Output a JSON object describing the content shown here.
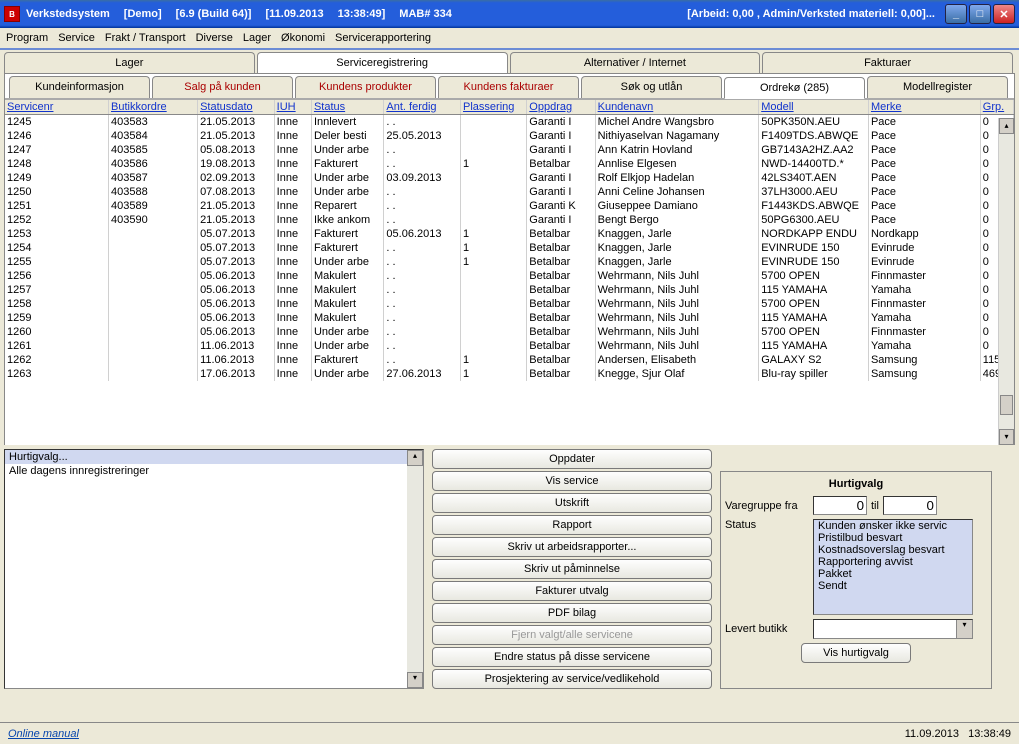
{
  "titlebar": {
    "app": "Verkstedsystem",
    "demo": "[Demo]",
    "build": "[6.9 (Build 64)]",
    "date": "[11.09.2013",
    "time": "13:38:49]",
    "mab": "MAB# 334",
    "right": "[Arbeid: 0,00 , Admin/Verksted materiell: 0,00]..."
  },
  "menu": [
    "Program",
    "Service",
    "Frakt / Transport",
    "Diverse",
    "Lager",
    "Økonomi",
    "Servicerapportering"
  ],
  "tabs_level1": [
    "Lager",
    "Serviceregistrering",
    "Alternativer / Internet",
    "Fakturaer"
  ],
  "tabs_level1_active": 1,
  "tabs_level2": [
    {
      "label": "Kundeinformasjon",
      "red": false
    },
    {
      "label": "Salg på kunden",
      "red": true
    },
    {
      "label": "Kundens produkter",
      "red": true
    },
    {
      "label": "Kundens fakturaer",
      "red": true
    },
    {
      "label": "Søk og utlån",
      "red": false
    },
    {
      "label": "Ordrekø (285)",
      "red": false,
      "active": true
    },
    {
      "label": "Modellregister",
      "red": false
    }
  ],
  "columns": [
    "Servicenr",
    "Butikkordre",
    "Statusdato",
    "IUH",
    "Status",
    "Ant. ferdig",
    "Plassering",
    "Oppdrag",
    "Kundenavn",
    "Modell",
    "Merke",
    "Grp."
  ],
  "rows": [
    {
      "c": [
        "1245",
        "403583",
        "21.05.2013",
        "Inne",
        "Innlevert",
        ". .",
        "",
        "Garanti I",
        "Michel Andre Wangsbro",
        "50PK350N.AEU",
        "Pace",
        "0"
      ]
    },
    {
      "c": [
        "1246",
        "403584",
        "21.05.2013",
        "Inne",
        "Deler besti",
        "25.05.2013",
        "",
        "Garanti I",
        "Nithiyaselvan Nagamany",
        "F1409TDS.ABWQE",
        "Pace",
        "0"
      ]
    },
    {
      "c": [
        "1247",
        "403585",
        "05.08.2013",
        "Inne",
        "Under arbe",
        ". .",
        "",
        "Garanti I",
        "Ann Katrin Hovland",
        "GB7143A2HZ.AA2",
        "Pace",
        "0"
      ]
    },
    {
      "c": [
        "1248",
        "403586",
        "19.08.2013",
        "Inne",
        "Fakturert",
        ". .",
        "1",
        "Betalbar",
        "Annlise Elgesen",
        "NWD-14400TD.*",
        "Pace",
        "0"
      ]
    },
    {
      "c": [
        "1249",
        "403587",
        "02.09.2013",
        "Inne",
        "Under arbe",
        "03.09.2013",
        "",
        "Garanti I",
        "Rolf Elkjop Hadelan",
        "42LS340T.AEN",
        "Pace",
        "0"
      ]
    },
    {
      "c": [
        "1250",
        "403588",
        "07.08.2013",
        "Inne",
        "Under arbe",
        ". .",
        "",
        "Garanti I",
        "Anni Celine Johansen",
        "37LH3000.AEU",
        "Pace",
        "0"
      ]
    },
    {
      "c": [
        "1251",
        "403589",
        "21.05.2013",
        "Inne",
        "Reparert",
        ". .",
        "",
        "Garanti K",
        "Giuseppee Damiano",
        "F1443KDS.ABWQE",
        "Pace",
        "0"
      ]
    },
    {
      "c": [
        "1252",
        "403590",
        "21.05.2013",
        "Inne",
        "Ikke ankom",
        ". .",
        "",
        "Garanti I",
        "Bengt Bergo",
        "50PG6300.AEU",
        "Pace",
        "0"
      ]
    },
    {
      "c": [
        "1253",
        "",
        "05.07.2013",
        "Inne",
        "Fakturert",
        "05.06.2013",
        "1",
        "Betalbar",
        "Knaggen, Jarle",
        "NORDKAPP ENDU",
        "Nordkapp",
        "0"
      ]
    },
    {
      "c": [
        "1254",
        "",
        "05.07.2013",
        "Inne",
        "Fakturert",
        ". .",
        "1",
        "Betalbar",
        "Knaggen, Jarle",
        "EVINRUDE 150",
        "Evinrude",
        "0"
      ]
    },
    {
      "c": [
        "1255",
        "",
        "05.07.2013",
        "Inne",
        "Under arbe",
        ". .",
        "1",
        "Betalbar",
        "Knaggen, Jarle",
        "EVINRUDE 150",
        "Evinrude",
        "0"
      ]
    },
    {
      "c": [
        "1256",
        "",
        "05.06.2013",
        "Inne",
        "Makulert",
        ". .",
        "",
        "Betalbar",
        "Wehrmann, Nils Juhl",
        "5700 OPEN",
        "Finnmaster",
        "0"
      ]
    },
    {
      "c": [
        "1257",
        "",
        "05.06.2013",
        "Inne",
        "Makulert",
        ". .",
        "",
        "Betalbar",
        "Wehrmann, Nils Juhl",
        "115 YAMAHA",
        "Yamaha",
        "0"
      ]
    },
    {
      "c": [
        "1258",
        "",
        "05.06.2013",
        "Inne",
        "Makulert",
        ". .",
        "",
        "Betalbar",
        "Wehrmann, Nils Juhl",
        "5700 OPEN",
        "Finnmaster",
        "0"
      ]
    },
    {
      "c": [
        "1259",
        "",
        "05.06.2013",
        "Inne",
        "Makulert",
        ". .",
        "",
        "Betalbar",
        "Wehrmann, Nils Juhl",
        "115 YAMAHA",
        "Yamaha",
        "0"
      ]
    },
    {
      "c": [
        "1260",
        "",
        "05.06.2013",
        "Inne",
        "Under arbe",
        ". .",
        "",
        "Betalbar",
        "Wehrmann, Nils Juhl",
        "5700 OPEN",
        "Finnmaster",
        "0"
      ]
    },
    {
      "c": [
        "1261",
        "",
        "11.06.2013",
        "Inne",
        "Under arbe",
        ". .",
        "",
        "Betalbar",
        "Wehrmann, Nils Juhl",
        "115 YAMAHA",
        "Yamaha",
        "0"
      ]
    },
    {
      "c": [
        "1262",
        "",
        "11.06.2013",
        "Inne",
        "Fakturert",
        ". .",
        "1",
        "Betalbar",
        "Andersen, Elisabeth",
        "GALAXY S2",
        "Samsung",
        "115"
      ]
    },
    {
      "c": [
        "1263",
        "",
        "17.06.2013",
        "Inne",
        "Under arbe",
        "27.06.2013",
        "1",
        "Betalbar",
        "Knegge, Sjur Olaf",
        "Blu-ray spiller",
        "Samsung",
        "469"
      ]
    }
  ],
  "hurtigvalg_panel": {
    "title": "Hurtigvalg...",
    "item": "Alle dagens innregistreringer"
  },
  "buttons_center": [
    "Oppdater",
    "Vis service",
    "Utskrift",
    "Rapport",
    "Skriv ut arbeidsrapporter...",
    "Skriv ut påminnelse",
    "Fakturer utvalg",
    "PDF bilag",
    "Fjern valgt/alle servicene",
    "Endre status på disse servicene",
    "Prosjektering av service/vedlikehold"
  ],
  "disabled_button_index": 8,
  "right_panel": {
    "title": "Hurtigvalg",
    "varegruppe_label": "Varegruppe fra",
    "varegruppe_from": "0",
    "til_label": "til",
    "varegruppe_to": "0",
    "status_label": "Status",
    "status_items": [
      "Kunden ønsker ikke servic",
      "Pristilbud besvart",
      "Kostnadsoverslag besvart",
      "Rapportering avvist",
      "Pakket",
      "Sendt"
    ],
    "levert_label": "Levert butikk",
    "show_btn": "Vis hurtigvalg"
  },
  "footer": {
    "link": "Online manual",
    "date": "11.09.2013",
    "time": "13:38:49"
  }
}
